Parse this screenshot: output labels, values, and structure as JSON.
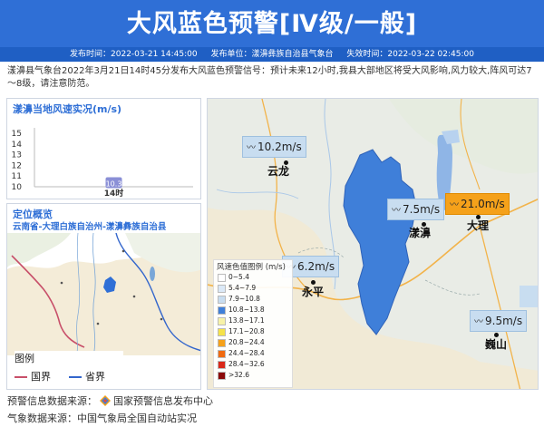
{
  "header": {
    "title": "大风蓝色预警[Ⅳ级/一般]",
    "publish_time": "发布时间：2022-03-21 14:45:00",
    "publisher": "发布单位：漾濞彝族自治县气象台",
    "expire_time": "失效时间：2022-03-22 02:45:00"
  },
  "description": "漾濞县气象台2022年3月21日14时45分发布大风蓝色预警信号：预计未来12小时,我县大部地区将受大风影响,风力较大,阵风可达7～8级，请注意防范。",
  "wind_chart": {
    "title": "漾濞当地风速实况(m/s)"
  },
  "chart_data": {
    "type": "scatter",
    "title": "漾濞当地风速实况(m/s)",
    "categories": [
      "14时"
    ],
    "values": [
      10.3
    ],
    "data_labels": [
      "10.3"
    ],
    "y_ticks": [
      "15",
      "14",
      "13",
      "12",
      "11",
      "10"
    ],
    "ylim": [
      10,
      15
    ]
  },
  "location": {
    "title": "定位概览",
    "path": "云南省-大理白族自治州-漾濞彝族自治县",
    "legend_title": "图例",
    "legend_items": [
      {
        "label": "国界",
        "color": "#c8506a"
      },
      {
        "label": "省界",
        "color": "#3366cc"
      }
    ]
  },
  "main_map": {
    "stations": [
      {
        "city": "云龙",
        "wind": "10.2m/s",
        "highlight": false
      },
      {
        "city": "漾濞",
        "wind": "7.5m/s",
        "highlight": false
      },
      {
        "city": "大理",
        "wind": "21.0m/s",
        "highlight": true
      },
      {
        "city": "永平",
        "wind": "6.2m/s",
        "highlight": false
      },
      {
        "city": "巍山",
        "wind": "9.5m/s",
        "highlight": false
      }
    ],
    "legend": {
      "title": "风速色值图例 (m/s)",
      "items": [
        {
          "label": "0~5.4",
          "color": "#ffffff"
        },
        {
          "label": "5.4~7.9",
          "color": "#dbe9f7"
        },
        {
          "label": "7.9~10.8",
          "color": "#c8ddf0"
        },
        {
          "label": "10.8~13.8",
          "color": "#3f7fd9"
        },
        {
          "label": "13.8~17.1",
          "color": "#f7f2a8"
        },
        {
          "label": "17.1~20.8",
          "color": "#f5e24a"
        },
        {
          "label": "20.8~24.4",
          "color": "#f5a11a"
        },
        {
          "label": "24.4~28.4",
          "color": "#f06a10"
        },
        {
          "label": "28.4~32.6",
          "color": "#d9281a"
        },
        {
          "label": ">32.6",
          "color": "#8b0a0a"
        }
      ]
    }
  },
  "footer": {
    "warning_source_label": "预警信息数据来源：",
    "warning_source_name": "国家预警信息发布中心",
    "weather_source": "气象数据来源：中国气象局全国自动站实况"
  }
}
